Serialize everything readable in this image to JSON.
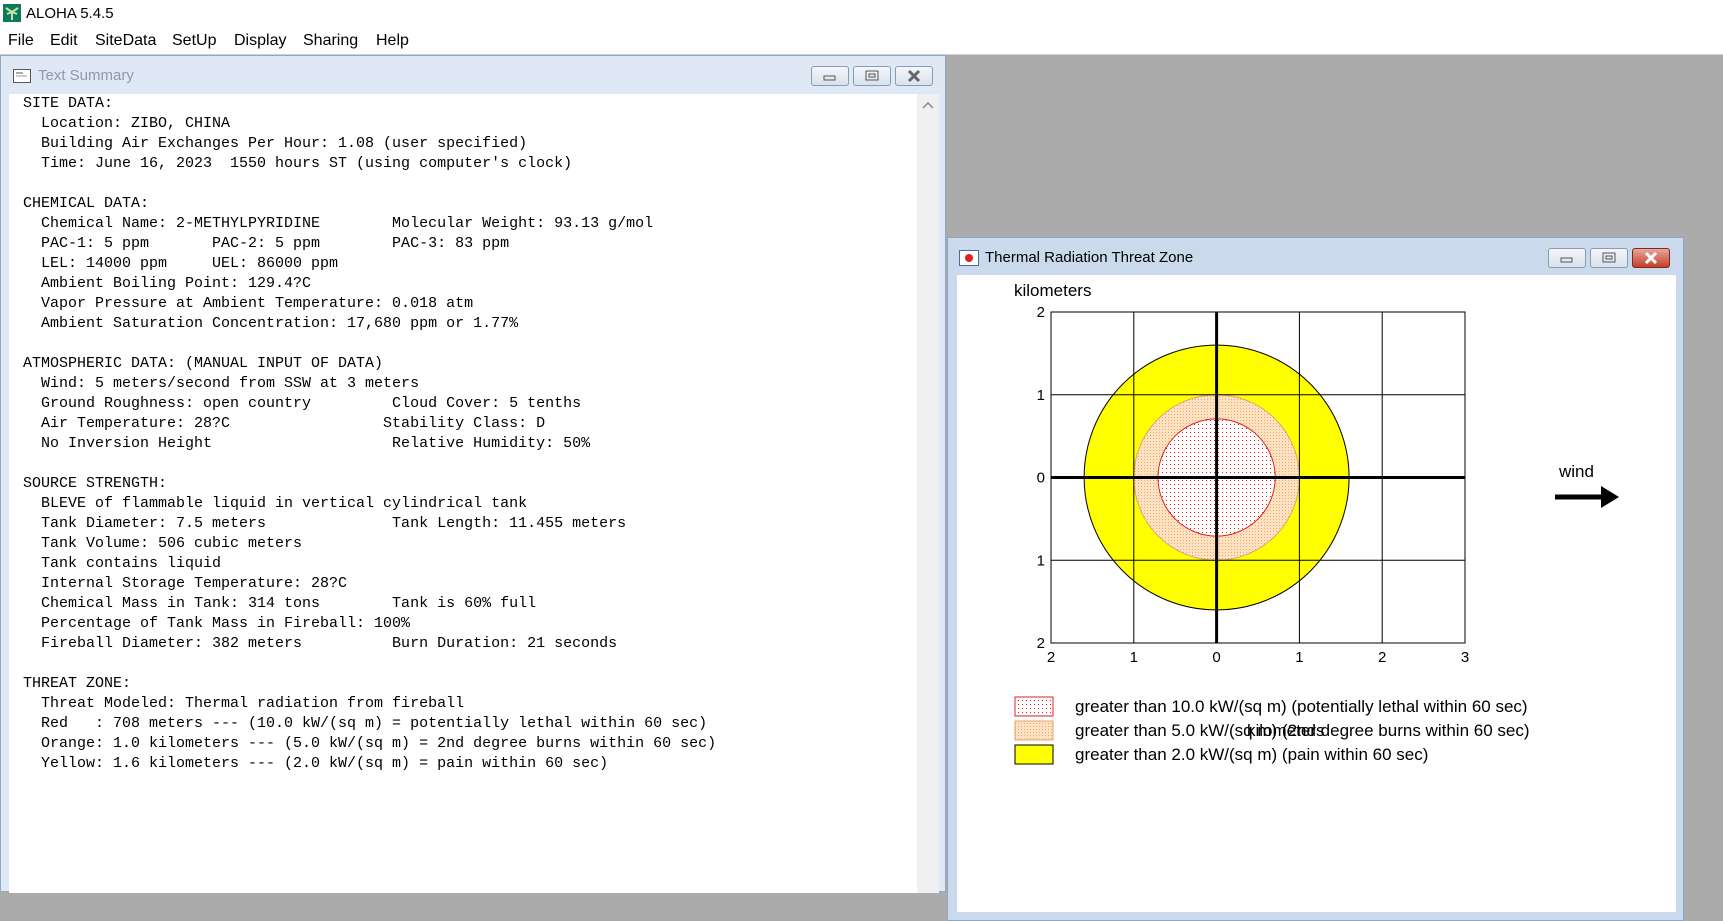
{
  "app": {
    "title": "ALOHA 5.4.5"
  },
  "menu": [
    {
      "label": "File"
    },
    {
      "label": "Edit"
    },
    {
      "label": "SiteData"
    },
    {
      "label": "SetUp"
    },
    {
      "label": "Display"
    },
    {
      "label": "Sharing"
    },
    {
      "label": "Help"
    }
  ],
  "text_summary": {
    "title": "Text Summary",
    "lines": [
      "SITE DATA:",
      "  Location: ZIBO, CHINA",
      "  Building Air Exchanges Per Hour: 1.08 (user specified)",
      "  Time: June 16, 2023  1550 hours ST (using computer's clock)",
      "",
      "CHEMICAL DATA:",
      "  Chemical Name: 2-METHYLPYRIDINE        Molecular Weight: 93.13 g/mol",
      "  PAC-1: 5 ppm       PAC-2: 5 ppm        PAC-3: 83 ppm",
      "  LEL: 14000 ppm     UEL: 86000 ppm",
      "  Ambient Boiling Point: 129.4?C",
      "  Vapor Pressure at Ambient Temperature: 0.018 atm",
      "  Ambient Saturation Concentration: 17,680 ppm or 1.77%",
      "",
      "ATMOSPHERIC DATA: (MANUAL INPUT OF DATA)",
      "  Wind: 5 meters/second from SSW at 3 meters",
      "  Ground Roughness: open country         Cloud Cover: 5 tenths",
      "  Air Temperature: 28?C                 Stability Class: D",
      "  No Inversion Height                    Relative Humidity: 50%",
      "",
      "SOURCE STRENGTH:",
      "  BLEVE of flammable liquid in vertical cylindrical tank",
      "  Tank Diameter: 7.5 meters              Tank Length: 11.455 meters",
      "  Tank Volume: 506 cubic meters",
      "  Tank contains liquid",
      "  Internal Storage Temperature: 28?C",
      "  Chemical Mass in Tank: 314 tons        Tank is 60% full",
      "  Percentage of Tank Mass in Fireball: 100%",
      "  Fireball Diameter: 382 meters          Burn Duration: 21 seconds",
      "",
      "THREAT ZONE:",
      "  Threat Modeled: Thermal radiation from fireball",
      "  Red   : 708 meters --- (10.0 kW/(sq m) = potentially lethal within 60 sec)",
      "  Orange: 1.0 kilometers --- (5.0 kW/(sq m) = 2nd degree burns within 60 sec)",
      "  Yellow: 1.6 kilometers --- (2.0 kW/(sq m) = pain within 60 sec)"
    ]
  },
  "threat_window": {
    "title": "Thermal Radiation Threat Zone",
    "wind_label": "wind"
  },
  "chart_data": {
    "type": "threat-zone-map",
    "ylabel": "kilometers",
    "xlabel": "kilometers",
    "x_ticks": [
      "2",
      "1",
      "0",
      "1",
      "2",
      "3"
    ],
    "y_ticks": [
      "2",
      "1",
      "0",
      "1",
      "2"
    ],
    "xlim": [
      -2,
      3
    ],
    "ylim": [
      -2,
      2
    ],
    "zones": [
      {
        "name": "yellow",
        "radius_km": 1.6,
        "color": "#ffff00",
        "fill": "solid"
      },
      {
        "name": "orange",
        "radius_km": 1.0,
        "color": "#fbd9b0",
        "fill": "dotted"
      },
      {
        "name": "red",
        "radius_km": 0.708,
        "color": "#ff0000",
        "fill": "dotted"
      }
    ],
    "legend": [
      {
        "label": "greater than 10.0 kW/(sq m) (potentially lethal within 60 sec)",
        "swatch": "red"
      },
      {
        "label": "greater than 5.0 kW/(sq m) (2nd degree burns within 60 sec)",
        "swatch": "orange"
      },
      {
        "label": "greater than 2.0 kW/(sq m) (pain within 60 sec)",
        "swatch": "yellow"
      }
    ]
  }
}
